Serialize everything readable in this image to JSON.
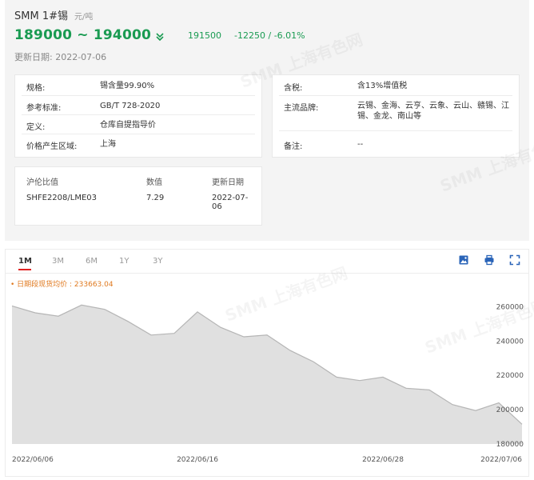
{
  "header": {
    "title": "SMM 1#锡",
    "unit": "元/吨",
    "price_range": "189000 ~ 194000",
    "average": "191500",
    "change": "-12250 / -6.01%",
    "update_label": "更新日期:",
    "update_date": "2022-07-06"
  },
  "specs_left": [
    {
      "key": "规格:",
      "value": "锡含量99.90%"
    },
    {
      "key": "参考标准:",
      "value": "GB/T 728-2020"
    },
    {
      "key": "定义:",
      "value": "仓库自提指导价"
    },
    {
      "key": "价格产生区域:",
      "value": "上海"
    }
  ],
  "specs_right": [
    {
      "key": "含税:",
      "value": "含13%增值税"
    },
    {
      "key": "主流品牌:",
      "value": "云锡、金海、云亨、云象、云山、赣锡、江锡、金龙、南山等"
    },
    {
      "key": "备注:",
      "value": "--"
    }
  ],
  "ratio": {
    "headers": [
      "沪伦比值",
      "数值",
      "更新日期"
    ],
    "row": [
      "SHFE2208/LME03",
      "7.29",
      "2022-07-06"
    ]
  },
  "chart_tabs": [
    "1M",
    "3M",
    "6M",
    "1Y",
    "3Y"
  ],
  "active_tab": "1M",
  "toolbar_icons": [
    "image-download-icon",
    "print-icon",
    "fullscreen-icon"
  ],
  "watermark": "SMM 上海有色网",
  "chart_data": {
    "type": "area",
    "legend": "• 日期段现货均价 : 233663.04",
    "x_tick_labels": [
      "2022/06/06",
      "2022/06/16",
      "2022/06/28",
      "2022/07/06"
    ],
    "x_tick_index": [
      0,
      8,
      16,
      22
    ],
    "y_tick_labels": [
      "260000",
      "240000",
      "220000",
      "200000",
      "180000"
    ],
    "ylim": [
      180000,
      270000
    ],
    "x": [
      "2022/06/06",
      "2022/06/07",
      "2022/06/08",
      "2022/06/09",
      "2022/06/10",
      "2022/06/13",
      "2022/06/14",
      "2022/06/15",
      "2022/06/16",
      "2022/06/17",
      "2022/06/20",
      "2022/06/21",
      "2022/06/22",
      "2022/06/23",
      "2022/06/24",
      "2022/06/27",
      "2022/06/28",
      "2022/06/29",
      "2022/06/30",
      "2022/07/01",
      "2022/07/04",
      "2022/07/05",
      "2022/07/06"
    ],
    "values": [
      260500,
      256500,
      254500,
      261000,
      258500,
      251500,
      243500,
      244500,
      257000,
      248000,
      242500,
      243500,
      234500,
      228000,
      219000,
      217000,
      219000,
      212500,
      211500,
      203000,
      199500,
      204000,
      191500
    ],
    "grid": false,
    "line_color": "#b5b5b5",
    "fill_color": "#e0e0e0"
  },
  "colors": {
    "price_down": "#1a9b52",
    "tab_underline": "#e02020",
    "legend_text": "#e07a20",
    "toolbar_icon": "#2a64b8"
  }
}
